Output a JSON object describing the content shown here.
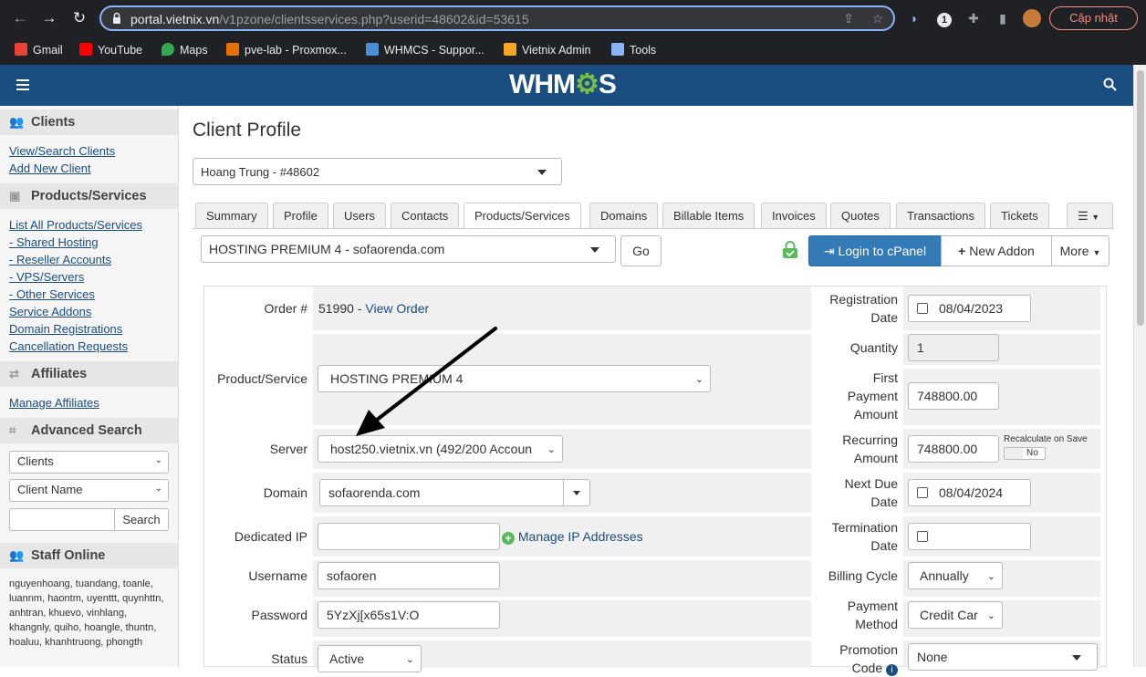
{
  "browser": {
    "url_host": "portal.vietnix.vn",
    "url_path": "/v1pzone/clientsservices.php?userid=48602&id=53615",
    "update_label": "Cập nhật",
    "bookmarks": [
      {
        "label": "Gmail",
        "color": "#ea4335"
      },
      {
        "label": "YouTube",
        "color": "#ff0000"
      },
      {
        "label": "Maps",
        "color": "#34a853"
      },
      {
        "label": "pve-lab - Proxmox...",
        "color": "#e57000"
      },
      {
        "label": "WHMCS - Suppor...",
        "color": "#4a8fd6"
      },
      {
        "label": "Vietnix Admin",
        "color": "#f5a623"
      },
      {
        "label": "Tools",
        "color": "#8ab4f8"
      }
    ]
  },
  "header": {
    "logo_text": "WHM",
    "logo_gear": "⚙",
    "logo_tail": "S"
  },
  "sidebar": {
    "clients_title": "Clients",
    "clients_links": [
      "View/Search Clients",
      "Add New Client"
    ],
    "products_title": "Products/Services",
    "products_links": [
      "List All Products/Services",
      "- Shared Hosting",
      "- Reseller Accounts",
      "- VPS/Servers",
      "- Other Services",
      "Service Addons",
      "Domain Registrations",
      "Cancellation Requests"
    ],
    "affiliates_title": "Affiliates",
    "affiliates_links": [
      "Manage Affiliates"
    ],
    "search_title": "Advanced Search",
    "search_type": "Clients",
    "search_field": "Client Name",
    "search_button": "Search",
    "staff_title": "Staff Online",
    "staff_list": "nguyenhoang, tuandang, toanle, luannm, haontm, uyenttt, quynhttn, anhtran, khuevo, vinhlang, khangnly, quiho, hoangle, thuntn, hoaluu, khanhtruong, phongth"
  },
  "page": {
    "title": "Client Profile",
    "client_select": "Hoang Trung - #48602",
    "tabs": [
      "Summary",
      "Profile",
      "Users",
      "Contacts",
      "Products/Services",
      "Domains",
      "Billable Items",
      "Invoices",
      "Quotes",
      "Transactions",
      "Tickets"
    ],
    "active_tab": "Products/Services",
    "service_select": "HOSTING PREMIUM 4 - sofaorenda.com",
    "go_button": "Go",
    "login_cpanel": "Login to cPanel",
    "new_addon": "New Addon",
    "more": "More"
  },
  "form": {
    "order_label": "Order #",
    "order_number": "51990 - ",
    "view_order": "View Order",
    "product_label": "Product/Service",
    "product_value": "HOSTING PREMIUM 4",
    "server_label": "Server",
    "server_value": "host250.vietnix.vn (492/200 Accoun",
    "domain_label": "Domain",
    "domain_value": "sofaorenda.com",
    "dedicated_ip_label": "Dedicated IP",
    "dedicated_ip_value": "",
    "manage_ip": "Manage IP Addresses",
    "username_label": "Username",
    "username_value": "sofaoren",
    "password_label": "Password",
    "password_value": "5YzXj[x65s1V:O",
    "status_label": "Status",
    "status_value": "Active",
    "reg_date_label_1": "Registration",
    "reg_date_label_2": "Date",
    "reg_date_value": "08/04/2023",
    "quantity_label": "Quantity",
    "quantity_value": "1",
    "first_payment_label_1": "First",
    "first_payment_label_2": "Payment",
    "first_payment_label_3": "Amount",
    "first_payment_value": "748800.00",
    "recurring_label_1": "Recurring",
    "recurring_label_2": "Amount",
    "recurring_value": "748800.00",
    "recalc_label": "Recalculate on Save",
    "recalc_toggle": "No",
    "next_due_label_1": "Next Due",
    "next_due_label_2": "Date",
    "next_due_value": "08/04/2024",
    "termination_label_1": "Termination",
    "termination_label_2": "Date",
    "termination_value": "",
    "billing_cycle_label": "Billing Cycle",
    "billing_cycle_value": "Annually",
    "payment_method_label_1": "Payment",
    "payment_method_label_2": "Method",
    "payment_method_value": "Credit Car",
    "promotion_label_1": "Promotion",
    "promotion_label_2": "Code",
    "promotion_value": "None"
  }
}
